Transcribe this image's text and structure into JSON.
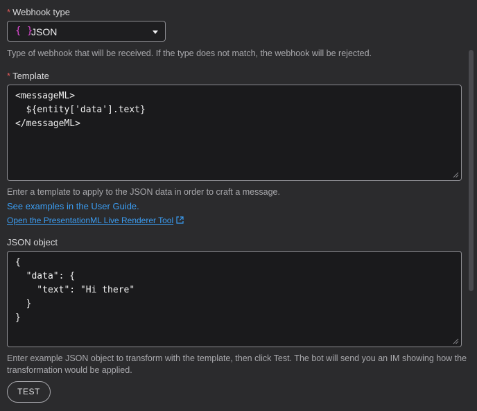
{
  "webhook_type": {
    "label": "Webhook type",
    "required_mark": "*",
    "icon": "{ }",
    "selected": "JSON",
    "help": "Type of webhook that will be received. If the type does not match, the webhook will be rejected."
  },
  "template": {
    "label": "Template",
    "required_mark": "*",
    "value": "<messageML>\n  ${entity['data'].text}\n</messageML>",
    "help": "Enter a template to apply to the JSON data in order to craft a message.",
    "guide_link": "See examples in the User Guide.",
    "renderer_link": "Open the PresentationML Live Renderer Tool"
  },
  "json_object": {
    "label": "JSON object",
    "value": "{\n  \"data\": {\n    \"text\": \"Hi there\"\n  }\n}",
    "help": "Enter example JSON object to transform with the template, then click Test. The bot will send you an IM showing how the transformation would be applied."
  },
  "test_button": {
    "label": "TEST"
  }
}
